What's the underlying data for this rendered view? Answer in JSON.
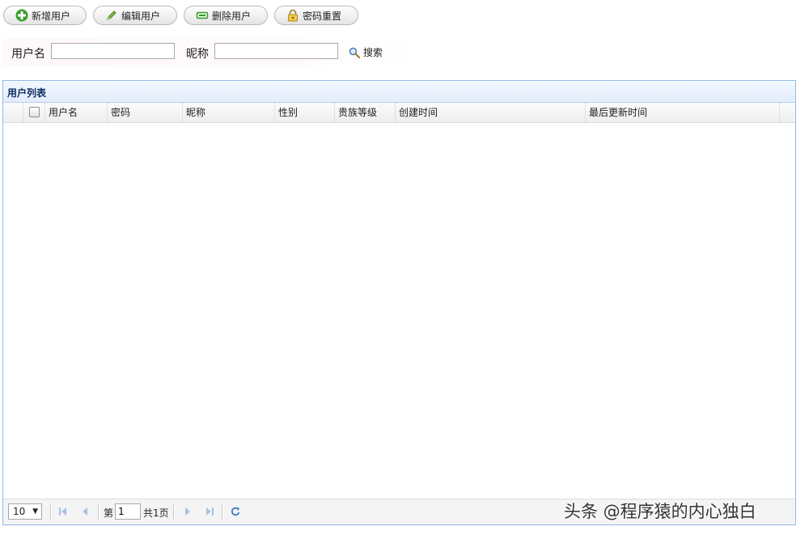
{
  "toolbar": {
    "add_label": "新增用户",
    "edit_label": "编辑用户",
    "delete_label": "删除用户",
    "reset_password_label": "密码重置"
  },
  "search": {
    "username_label": "用户名",
    "username_value": "",
    "nickname_label": "昵称",
    "nickname_value": "",
    "search_label": "搜索"
  },
  "grid": {
    "title": "用户列表",
    "columns": [
      "用户名",
      "密码",
      "昵称",
      "性别",
      "贵族等级",
      "创建时间",
      "最后更新时间"
    ],
    "rows": []
  },
  "pager": {
    "page_size": "10",
    "page_prefix": "第",
    "current_page": "1",
    "total_pages": "共1页"
  },
  "watermark": "头条 @程序猿的内心独白",
  "colors": {
    "panel_border": "#95b8e7",
    "panel_header": "#e1ecfb",
    "title_text": "#0e2d5f",
    "add_icon": "#3a9e2f",
    "delete_icon": "#2e9a2e"
  }
}
